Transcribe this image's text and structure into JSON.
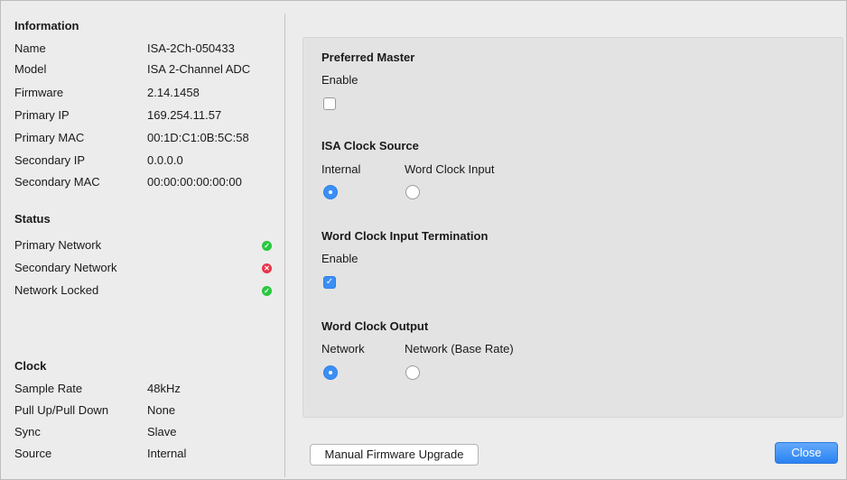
{
  "information": {
    "title": "Information",
    "rows": [
      {
        "label": "Name",
        "value": "ISA-2Ch-050433"
      },
      {
        "label": "Model",
        "value": "ISA 2-Channel ADC"
      },
      {
        "label": "Firmware",
        "value": "2.14.1458"
      },
      {
        "label": "Primary IP",
        "value": "169.254.11.57"
      },
      {
        "label": "Primary MAC",
        "value": "00:1D:C1:0B:5C:58"
      },
      {
        "label": "Secondary IP",
        "value": "0.0.0.0"
      },
      {
        "label": "Secondary MAC",
        "value": "00:00:00:00:00:00"
      }
    ]
  },
  "status": {
    "title": "Status",
    "rows": [
      {
        "label": "Primary Network",
        "state": "ok"
      },
      {
        "label": "Secondary Network",
        "state": "error"
      },
      {
        "label": "Network Locked",
        "state": "ok"
      }
    ]
  },
  "clock": {
    "title": "Clock",
    "rows": [
      {
        "label": "Sample Rate",
        "value": "48kHz"
      },
      {
        "label": "Pull Up/Pull Down",
        "value": "None"
      },
      {
        "label": "Sync",
        "value": "Slave"
      },
      {
        "label": "Source",
        "value": "Internal"
      }
    ]
  },
  "preferred_master": {
    "title": "Preferred Master",
    "enable_label": "Enable",
    "enabled": false
  },
  "clock_source": {
    "title": "ISA  Clock Source",
    "options": [
      "Internal",
      "Word Clock Input"
    ],
    "selected": "Internal"
  },
  "word_clock_termination": {
    "title": "Word Clock Input Termination",
    "enable_label": "Enable",
    "enabled": true
  },
  "word_clock_output": {
    "title": "Word Clock Output",
    "options": [
      "Network",
      "Network (Base Rate)"
    ],
    "selected": "Network"
  },
  "buttons": {
    "upgrade": "Manual Firmware Upgrade",
    "close": "Close"
  },
  "colors": {
    "ok": "#28c840",
    "error": "#e8354a",
    "accent": "#3b8ff5"
  }
}
